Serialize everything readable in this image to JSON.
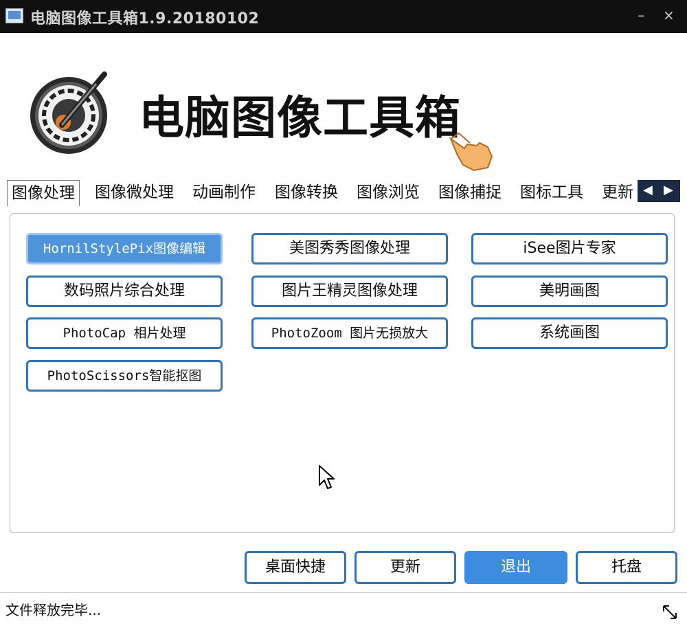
{
  "window": {
    "title": "电脑图像工具箱1.9.20180102",
    "minimize": "–",
    "close": "×"
  },
  "header": {
    "app_name": "电脑图像工具箱"
  },
  "tabs": [
    {
      "label": "图像处理",
      "active": true
    },
    {
      "label": "图像微处理",
      "active": false
    },
    {
      "label": "动画制作",
      "active": false
    },
    {
      "label": "图像转换",
      "active": false
    },
    {
      "label": "图像浏览",
      "active": false
    },
    {
      "label": "图像捕捉",
      "active": false
    },
    {
      "label": "图标工具",
      "active": false
    },
    {
      "label": "更新",
      "active": false
    }
  ],
  "tab_scroll": {
    "left": "◀",
    "right": "▶"
  },
  "tools": [
    {
      "label": "HornilStylePix图像编辑",
      "selected": true
    },
    {
      "label": "美图秀秀图像处理",
      "selected": false
    },
    {
      "label": "iSee图片专家",
      "selected": false
    },
    {
      "label": "数码照片综合处理",
      "selected": false
    },
    {
      "label": "图片王精灵图像处理",
      "selected": false
    },
    {
      "label": "美明画图",
      "selected": false
    },
    {
      "label": "PhotoCap 相片处理",
      "selected": false
    },
    {
      "label": "PhotoZoom 图片无损放大",
      "selected": false
    },
    {
      "label": "系统画图",
      "selected": false
    },
    {
      "label": "PhotoScissors智能抠图",
      "selected": false
    }
  ],
  "actions": {
    "desktop_shortcut": "桌面快捷",
    "update": "更新",
    "exit": "退出",
    "tray": "托盘"
  },
  "status": {
    "text": "文件释放完毕..."
  },
  "colors": {
    "accent": "#3574b4",
    "selected_fill": "#4f93db",
    "primary_button": "#3d8ce0",
    "titlebar": "#101010"
  }
}
